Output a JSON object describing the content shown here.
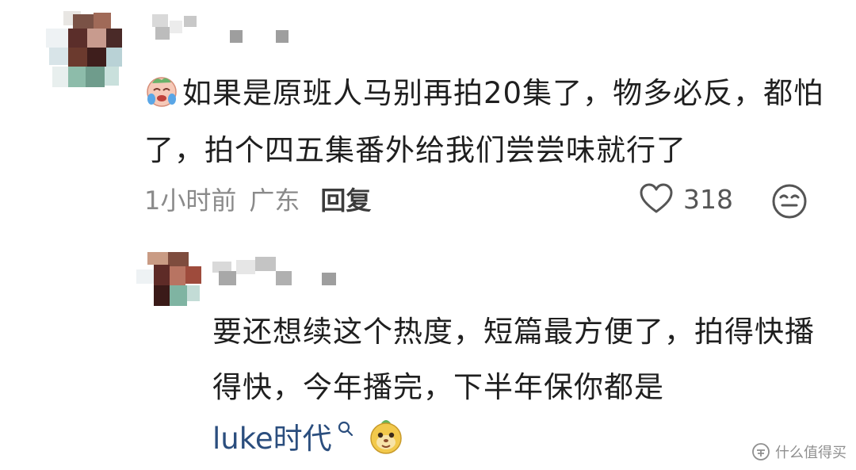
{
  "comment": {
    "emoji_name": "crying-laugh-emoji",
    "text": "如果是原班人马别再拍20集了，物多必反，都怕了，拍个四五集番外给我们尝尝味就行了",
    "time": "1小时前",
    "location": "广东",
    "reply_label": "回复",
    "like_count": "318",
    "like_icon": "heart-outline-icon",
    "emoji_react_icon": "smiley-face-icon"
  },
  "reply": {
    "text": "要还想续这个热度，短篇最方便了，拍得快播得快，今年播完，下半年保你都是",
    "mention": "luke时代",
    "mention_icon": "search-icon",
    "emoji_name": "monkey-emoji"
  },
  "watermark": {
    "text": "什么值得买"
  },
  "colors": {
    "mention": "#2b4e7e",
    "meta": "#8a8a8a",
    "reply_label": "#3c3c3c"
  }
}
